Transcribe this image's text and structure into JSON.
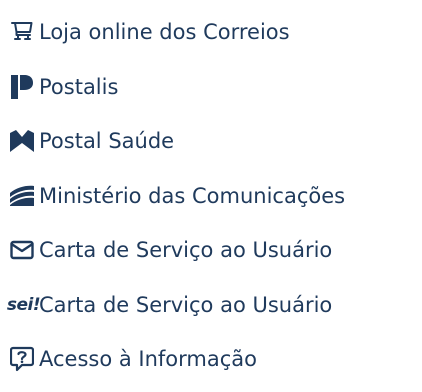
{
  "links": [
    {
      "label": "Loja online dos Correios",
      "icon": "shopping-cart-icon"
    },
    {
      "label": "Postalis",
      "icon": "postalis-logo-icon"
    },
    {
      "label": "Postal Saúde",
      "icon": "postal-saude-logo-icon"
    },
    {
      "label": "Ministério das Comunicações",
      "icon": "ministerio-comunicacoes-logo-icon"
    },
    {
      "label": "Carta de Serviço ao Usuário",
      "icon": "envelope-icon"
    },
    {
      "label": "Carta de Serviço ao Usuário",
      "icon": "sei-logo-icon"
    },
    {
      "label": "Acesso à Informação",
      "icon": "information-question-icon"
    }
  ],
  "icon_text": {
    "sei": "sei!"
  },
  "colors": {
    "text": "#1f3a5c",
    "icon": "#1f3a5c"
  }
}
